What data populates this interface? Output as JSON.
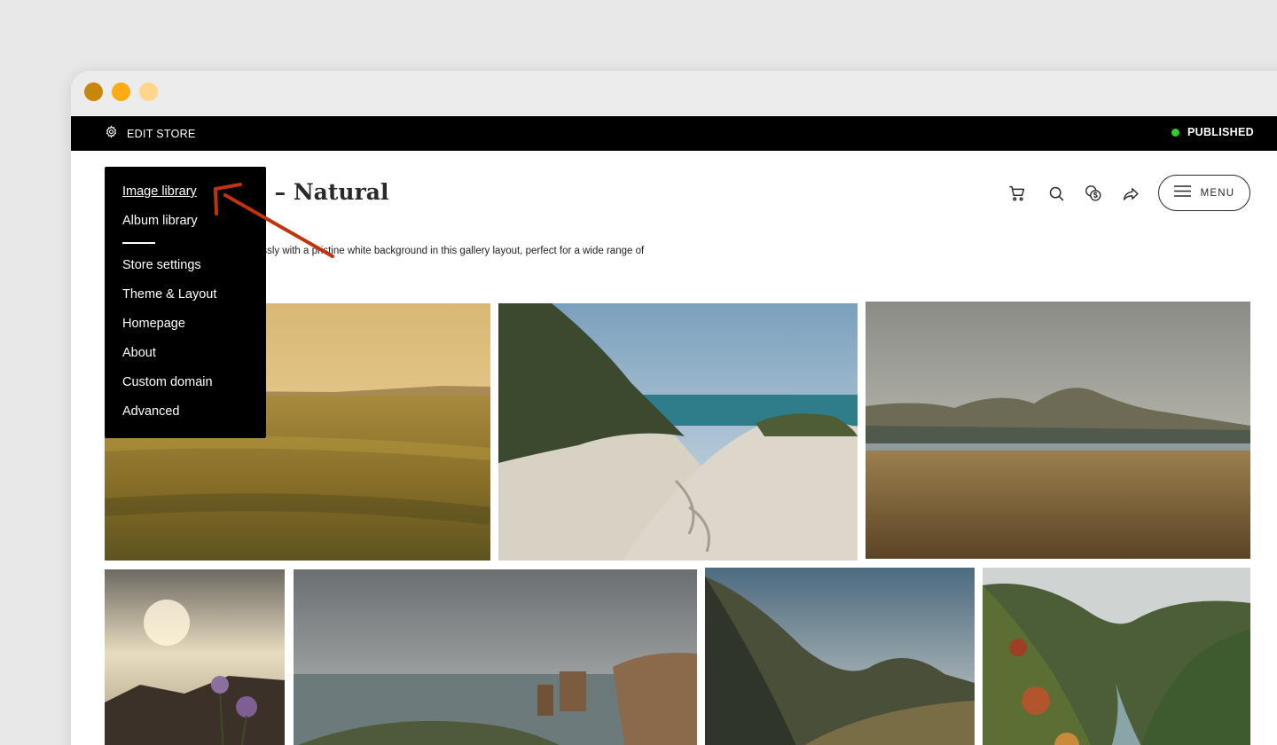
{
  "window": {
    "controls": [
      "close",
      "minimize",
      "zoom"
    ]
  },
  "editbar": {
    "edit_label": "EDIT STORE",
    "edit_icon": "gear-icon",
    "status_label": "PUBLISHED",
    "status_color": "#2bd02b"
  },
  "store": {
    "title_visible": "e – Natural",
    "description_visible": "nlessly with a pristine white background in this gallery layout, perfect for a wide range of"
  },
  "header": {
    "icons": [
      "cart-icon",
      "search-icon",
      "currency-icon",
      "share-icon"
    ],
    "menu_label": "MENU"
  },
  "dropdown": {
    "primary_items": [
      {
        "label": "Image library",
        "active": true
      },
      {
        "label": "Album library",
        "active": false
      }
    ],
    "secondary_items": [
      {
        "label": "Store settings"
      },
      {
        "label": "Theme & Layout"
      },
      {
        "label": "Homepage"
      },
      {
        "label": "About"
      },
      {
        "label": "Custom domain"
      },
      {
        "label": "Advanced"
      }
    ]
  },
  "gallery": {
    "photos": [
      {
        "subject": "golden grassland at sunset"
      },
      {
        "subject": "sand dune path to the sea"
      },
      {
        "subject": "mountains over golden marshland"
      },
      {
        "subject": "sunset over cliffs with purple flowers"
      },
      {
        "subject": "sea stacks along a rocky coast"
      },
      {
        "subject": "mountain valley under sunlit clouds"
      },
      {
        "subject": "autumn forest river gorge"
      }
    ]
  },
  "annotation": {
    "arrow_color": "#c0330e"
  }
}
